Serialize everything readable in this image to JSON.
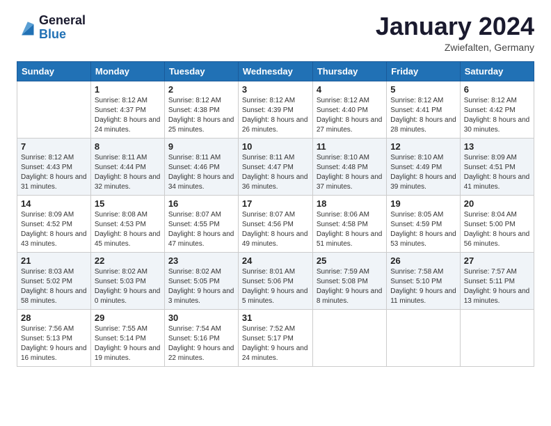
{
  "header": {
    "logo": {
      "line1": "General",
      "line2": "Blue"
    },
    "title": "January 2024",
    "subtitle": "Zwiefalten, Germany"
  },
  "days_of_week": [
    "Sunday",
    "Monday",
    "Tuesday",
    "Wednesday",
    "Thursday",
    "Friday",
    "Saturday"
  ],
  "weeks": [
    [
      {
        "day": "",
        "sunrise": "",
        "sunset": "",
        "daylight": ""
      },
      {
        "day": "1",
        "sunrise": "Sunrise: 8:12 AM",
        "sunset": "Sunset: 4:37 PM",
        "daylight": "Daylight: 8 hours and 24 minutes."
      },
      {
        "day": "2",
        "sunrise": "Sunrise: 8:12 AM",
        "sunset": "Sunset: 4:38 PM",
        "daylight": "Daylight: 8 hours and 25 minutes."
      },
      {
        "day": "3",
        "sunrise": "Sunrise: 8:12 AM",
        "sunset": "Sunset: 4:39 PM",
        "daylight": "Daylight: 8 hours and 26 minutes."
      },
      {
        "day": "4",
        "sunrise": "Sunrise: 8:12 AM",
        "sunset": "Sunset: 4:40 PM",
        "daylight": "Daylight: 8 hours and 27 minutes."
      },
      {
        "day": "5",
        "sunrise": "Sunrise: 8:12 AM",
        "sunset": "Sunset: 4:41 PM",
        "daylight": "Daylight: 8 hours and 28 minutes."
      },
      {
        "day": "6",
        "sunrise": "Sunrise: 8:12 AM",
        "sunset": "Sunset: 4:42 PM",
        "daylight": "Daylight: 8 hours and 30 minutes."
      }
    ],
    [
      {
        "day": "7",
        "sunrise": "Sunrise: 8:12 AM",
        "sunset": "Sunset: 4:43 PM",
        "daylight": "Daylight: 8 hours and 31 minutes."
      },
      {
        "day": "8",
        "sunrise": "Sunrise: 8:11 AM",
        "sunset": "Sunset: 4:44 PM",
        "daylight": "Daylight: 8 hours and 32 minutes."
      },
      {
        "day": "9",
        "sunrise": "Sunrise: 8:11 AM",
        "sunset": "Sunset: 4:46 PM",
        "daylight": "Daylight: 8 hours and 34 minutes."
      },
      {
        "day": "10",
        "sunrise": "Sunrise: 8:11 AM",
        "sunset": "Sunset: 4:47 PM",
        "daylight": "Daylight: 8 hours and 36 minutes."
      },
      {
        "day": "11",
        "sunrise": "Sunrise: 8:10 AM",
        "sunset": "Sunset: 4:48 PM",
        "daylight": "Daylight: 8 hours and 37 minutes."
      },
      {
        "day": "12",
        "sunrise": "Sunrise: 8:10 AM",
        "sunset": "Sunset: 4:49 PM",
        "daylight": "Daylight: 8 hours and 39 minutes."
      },
      {
        "day": "13",
        "sunrise": "Sunrise: 8:09 AM",
        "sunset": "Sunset: 4:51 PM",
        "daylight": "Daylight: 8 hours and 41 minutes."
      }
    ],
    [
      {
        "day": "14",
        "sunrise": "Sunrise: 8:09 AM",
        "sunset": "Sunset: 4:52 PM",
        "daylight": "Daylight: 8 hours and 43 minutes."
      },
      {
        "day": "15",
        "sunrise": "Sunrise: 8:08 AM",
        "sunset": "Sunset: 4:53 PM",
        "daylight": "Daylight: 8 hours and 45 minutes."
      },
      {
        "day": "16",
        "sunrise": "Sunrise: 8:07 AM",
        "sunset": "Sunset: 4:55 PM",
        "daylight": "Daylight: 8 hours and 47 minutes."
      },
      {
        "day": "17",
        "sunrise": "Sunrise: 8:07 AM",
        "sunset": "Sunset: 4:56 PM",
        "daylight": "Daylight: 8 hours and 49 minutes."
      },
      {
        "day": "18",
        "sunrise": "Sunrise: 8:06 AM",
        "sunset": "Sunset: 4:58 PM",
        "daylight": "Daylight: 8 hours and 51 minutes."
      },
      {
        "day": "19",
        "sunrise": "Sunrise: 8:05 AM",
        "sunset": "Sunset: 4:59 PM",
        "daylight": "Daylight: 8 hours and 53 minutes."
      },
      {
        "day": "20",
        "sunrise": "Sunrise: 8:04 AM",
        "sunset": "Sunset: 5:00 PM",
        "daylight": "Daylight: 8 hours and 56 minutes."
      }
    ],
    [
      {
        "day": "21",
        "sunrise": "Sunrise: 8:03 AM",
        "sunset": "Sunset: 5:02 PM",
        "daylight": "Daylight: 8 hours and 58 minutes."
      },
      {
        "day": "22",
        "sunrise": "Sunrise: 8:02 AM",
        "sunset": "Sunset: 5:03 PM",
        "daylight": "Daylight: 9 hours and 0 minutes."
      },
      {
        "day": "23",
        "sunrise": "Sunrise: 8:02 AM",
        "sunset": "Sunset: 5:05 PM",
        "daylight": "Daylight: 9 hours and 3 minutes."
      },
      {
        "day": "24",
        "sunrise": "Sunrise: 8:01 AM",
        "sunset": "Sunset: 5:06 PM",
        "daylight": "Daylight: 9 hours and 5 minutes."
      },
      {
        "day": "25",
        "sunrise": "Sunrise: 7:59 AM",
        "sunset": "Sunset: 5:08 PM",
        "daylight": "Daylight: 9 hours and 8 minutes."
      },
      {
        "day": "26",
        "sunrise": "Sunrise: 7:58 AM",
        "sunset": "Sunset: 5:10 PM",
        "daylight": "Daylight: 9 hours and 11 minutes."
      },
      {
        "day": "27",
        "sunrise": "Sunrise: 7:57 AM",
        "sunset": "Sunset: 5:11 PM",
        "daylight": "Daylight: 9 hours and 13 minutes."
      }
    ],
    [
      {
        "day": "28",
        "sunrise": "Sunrise: 7:56 AM",
        "sunset": "Sunset: 5:13 PM",
        "daylight": "Daylight: 9 hours and 16 minutes."
      },
      {
        "day": "29",
        "sunrise": "Sunrise: 7:55 AM",
        "sunset": "Sunset: 5:14 PM",
        "daylight": "Daylight: 9 hours and 19 minutes."
      },
      {
        "day": "30",
        "sunrise": "Sunrise: 7:54 AM",
        "sunset": "Sunset: 5:16 PM",
        "daylight": "Daylight: 9 hours and 22 minutes."
      },
      {
        "day": "31",
        "sunrise": "Sunrise: 7:52 AM",
        "sunset": "Sunset: 5:17 PM",
        "daylight": "Daylight: 9 hours and 24 minutes."
      },
      {
        "day": "",
        "sunrise": "",
        "sunset": "",
        "daylight": ""
      },
      {
        "day": "",
        "sunrise": "",
        "sunset": "",
        "daylight": ""
      },
      {
        "day": "",
        "sunrise": "",
        "sunset": "",
        "daylight": ""
      }
    ]
  ]
}
